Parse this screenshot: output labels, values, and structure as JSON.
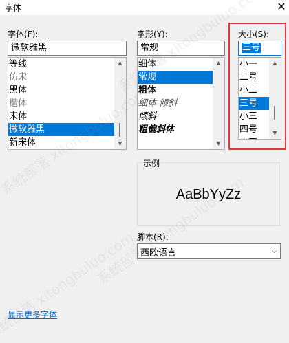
{
  "window": {
    "title": "字体",
    "close_glyph": "✕"
  },
  "font": {
    "label": "字体(F):",
    "value": "微软雅黑",
    "items": [
      "等线",
      "仿宋",
      "黑体",
      "楷体",
      "宋体",
      "微软雅黑",
      "新宋体"
    ],
    "selected_index": 5
  },
  "style": {
    "label": "字形(Y):",
    "value": "常规",
    "items": [
      "细体",
      "常规",
      "粗体",
      "细体 倾斜",
      "倾斜",
      "粗偏斜体"
    ],
    "selected_index": 1
  },
  "size": {
    "label": "大小(S):",
    "value": "三号",
    "items": [
      "小一",
      "二号",
      "小二",
      "三号",
      "小三",
      "四号",
      "小四"
    ],
    "selected_index": 3
  },
  "sample": {
    "label": "示例",
    "text": "AaBbYyZz"
  },
  "script": {
    "label": "脚本(R):",
    "value": "西欧语言"
  },
  "more_fonts_link": "显示更多字体",
  "watermark_lines": [
    "系统部落 xitongbuluo.com",
    "系统部落 xitongbuluo.com",
    "系统部落 xitongbuluo.com",
    "系统部落 xitongbuluo.com"
  ],
  "colors": {
    "accent": "#0078d7",
    "highlight": "#e23a3a",
    "link": "#0066cc"
  },
  "icons": {
    "scroll_up": "chevron-up-icon",
    "scroll_down": "chevron-down-icon",
    "dropdown": "chevron-down-icon"
  }
}
